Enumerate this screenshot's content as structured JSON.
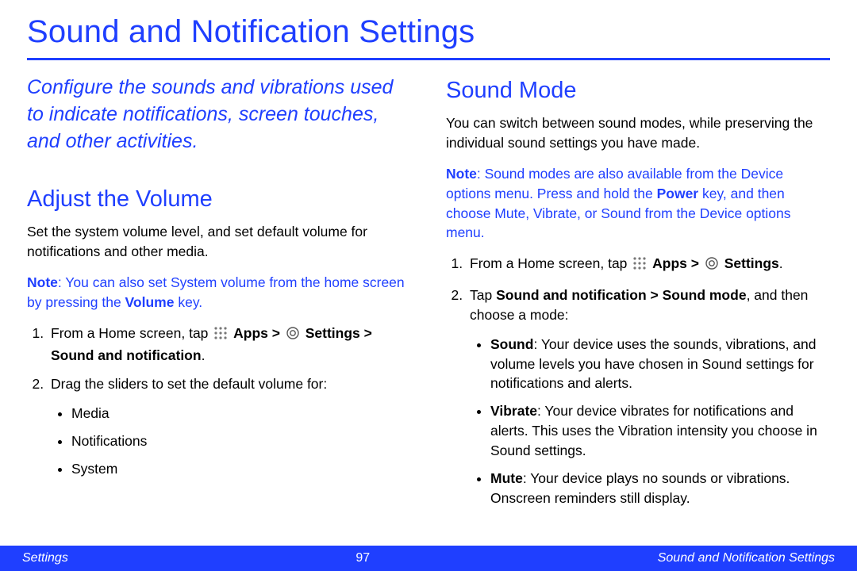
{
  "title": "Sound and Notification Settings",
  "intro": "Configure the sounds and vibrations used to indicate notifications, screen touches, and other activities.",
  "left": {
    "heading": "Adjust the Volume",
    "para": "Set the system volume level, and set default volume for notifications and other media.",
    "note_label": "Note",
    "note_body": ": You can also set System volume from the home screen by pressing the ",
    "note_bold": "Volume",
    "note_tail": " key.",
    "step1_a": "From a Home screen, tap ",
    "step1_apps": "Apps > ",
    "step1_settings": "Settings > Sound and notification",
    "step1_tail": ".",
    "step2": "Drag the sliders to set the default volume for:",
    "bullets": {
      "b1": "Media",
      "b2": "Notifications",
      "b3": "System"
    }
  },
  "right": {
    "heading": "Sound Mode",
    "para": "You can switch between sound modes, while preserving the individual sound settings you have made.",
    "note_label": "Note",
    "note_a": ": Sound modes are also available from the Device options menu. Press and hold the ",
    "note_bold": "Power",
    "note_b": " key, and then choose Mute, Vibrate, or Sound from the Device options menu.",
    "step1_a": "From a Home screen, tap ",
    "step1_apps": "Apps > ",
    "step1_settings": "Settings",
    "step1_tail": ".",
    "step2_a": "Tap ",
    "step2_bold": "Sound and notification > Sound mode",
    "step2_b": ", and then choose a mode:",
    "modes": {
      "sound_label": "Sound",
      "sound_body": ": Your device uses the sounds, vibrations, and volume levels you have chosen in Sound settings for notifications and alerts.",
      "vibrate_label": "Vibrate",
      "vibrate_body": ": Your device vibrates for notifications and alerts. This uses the Vibration intensity you choose in Sound settings.",
      "mute_label": "Mute",
      "mute_body": ": Your device plays no sounds or vibrations. Onscreen reminders still display."
    }
  },
  "footer": {
    "left": "Settings",
    "page": "97",
    "right": "Sound and Notification Settings"
  }
}
